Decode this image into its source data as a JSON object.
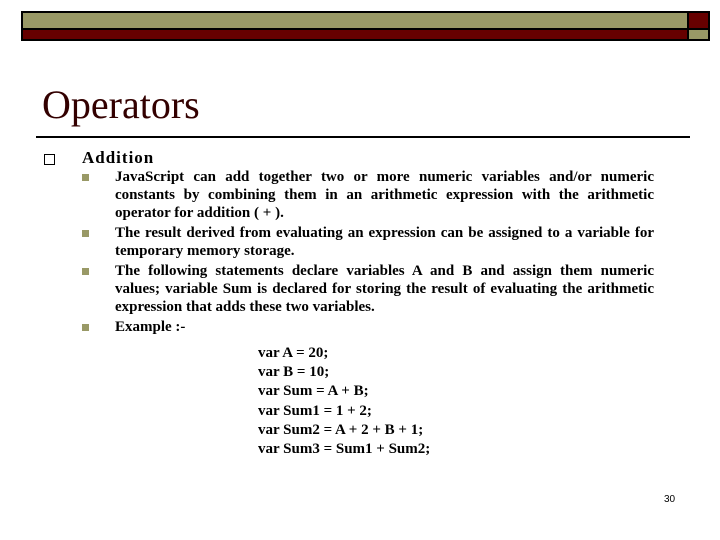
{
  "slide": {
    "title": "Operators",
    "page_number": "30",
    "colors": {
      "accent_olive": "#999966",
      "accent_red": "#660000",
      "title": "#330000"
    }
  },
  "content": {
    "level1": {
      "bullet_icon": "hollow-square",
      "text": "Addition"
    },
    "items": [
      {
        "bullet_icon": "filled-square",
        "text": "JavaScript can add together two or more numeric variables and/or numeric constants by combining them in an arithmetic expression with the arithmetic operator for addition ( + )."
      },
      {
        "bullet_icon": "filled-square",
        "text": "The result derived from evaluating an expression can be assigned to a variable for temporary memory storage."
      },
      {
        "bullet_icon": "filled-square",
        "text": "The following statements declare variables A and B and assign them numeric values; variable Sum is declared for storing the result of evaluating the arithmetic expression that adds these two variables."
      },
      {
        "bullet_icon": "filled-square",
        "text": "Example :-"
      }
    ],
    "code_lines": [
      "var A = 20;",
      "var B = 10;",
      "var Sum = A + B;",
      "var Sum1 = 1 + 2;",
      "var Sum2 = A + 2 + B + 1;",
      "var Sum3 = Sum1 + Sum2;"
    ]
  }
}
